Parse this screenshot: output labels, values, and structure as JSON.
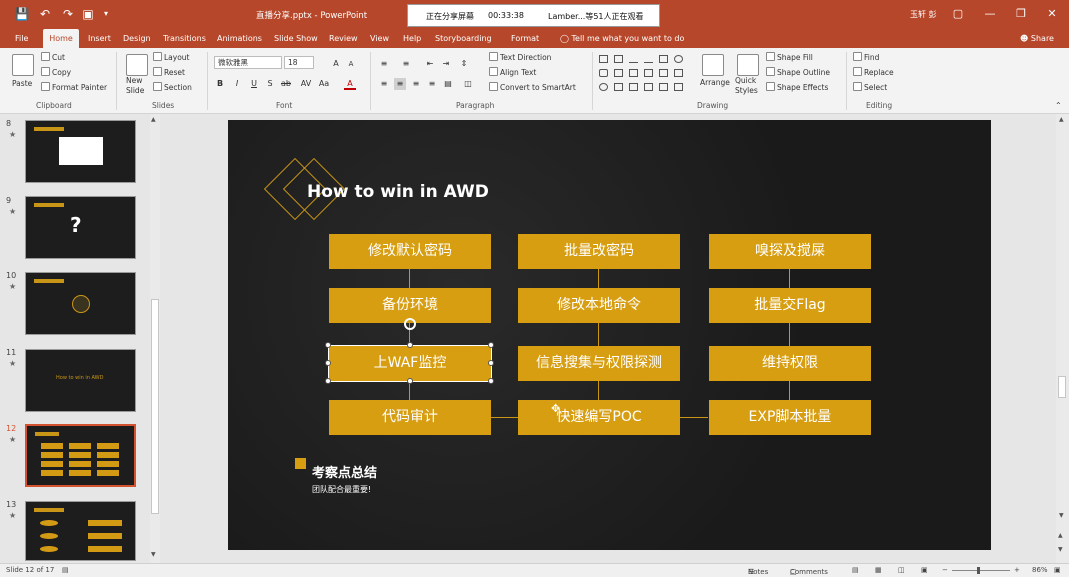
{
  "titlebar": {
    "save_icon": "save-icon",
    "undo_icon": "undo-icon",
    "redo_icon": "redo-icon",
    "present_icon": "present-icon",
    "doc_title": "直播分享.pptx  -  PowerPoint",
    "share_status": "正在分享屏幕",
    "share_time": "00:33:38",
    "share_viewers": "Lamber...等51人正在观看",
    "user": "玉轩 彭"
  },
  "menu": {
    "tabs": [
      "File",
      "Home",
      "Insert",
      "Design",
      "Transitions",
      "Animations",
      "Slide Show",
      "Review",
      "View",
      "Help",
      "Storyboarding",
      "Format"
    ],
    "active": "Home",
    "tell_me": "Tell me what you want to do",
    "share": "Share"
  },
  "ribbon": {
    "paste": "Paste",
    "cut": "Cut",
    "copy": "Copy",
    "format_painter": "Format Painter",
    "clipboard": "Clipboard",
    "new_slide": "New Slide",
    "layout": "Layout",
    "reset": "Reset",
    "section": "Section",
    "slides": "Slides",
    "font_name": "微软雅黑",
    "font_size": "18",
    "font": "Font",
    "text_direction": "Text Direction",
    "align_text": "Align Text",
    "convert_smartart": "Convert to SmartArt",
    "paragraph": "Paragraph",
    "arrange": "Arrange",
    "quick_styles": "Quick Styles",
    "shape_fill": "Shape Fill",
    "shape_outline": "Shape Outline",
    "shape_effects": "Shape Effects",
    "drawing": "Drawing",
    "find": "Find",
    "replace": "Replace",
    "select": "Select",
    "editing": "Editing"
  },
  "thumbnails": [
    {
      "num": "8"
    },
    {
      "num": "9",
      "text": "?"
    },
    {
      "num": "10"
    },
    {
      "num": "11",
      "text": "How to win in AWD"
    },
    {
      "num": "12"
    },
    {
      "num": "13"
    }
  ],
  "slide": {
    "title": "How to win in AWD",
    "boxes": [
      "修改默认密码",
      "批量改密码",
      "嗅探及搅屎",
      "备份环境",
      "修改本地命令",
      "批量交Flag",
      "上WAF监控",
      "信息搜集与权限探测",
      "维持权限",
      "代码审计",
      "快速编写POC",
      "EXP脚本批量"
    ],
    "summary_title": "考察点总结",
    "summary_sub": "团队配合最重要!"
  },
  "status": {
    "slide_info": "Slide 12 of 17",
    "notes": "Notes",
    "comments": "Comments",
    "zoom": "86%"
  },
  "colors": {
    "accent": "#b7472a",
    "box": "#d79e12"
  }
}
